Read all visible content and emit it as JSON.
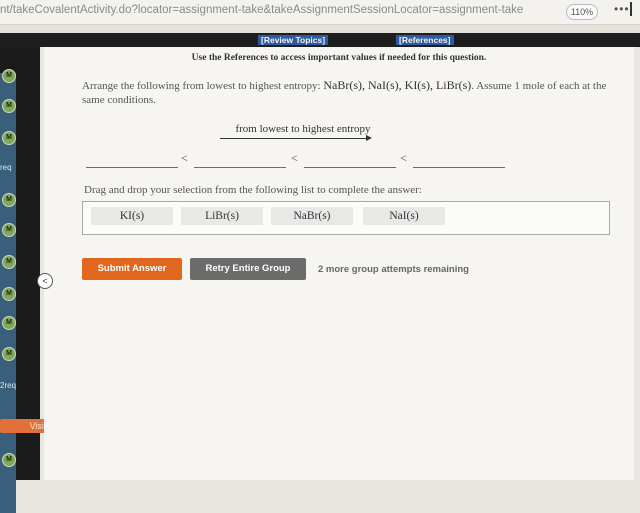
{
  "browser": {
    "url": "nt/takeCovalentActivity.do?locator=assignment-take&takeAssignmentSessionLocator=assignment-take",
    "zoom": "110%",
    "menu_glyph": "•••"
  },
  "header": {
    "review_topics": "[Review Topics]",
    "references": "[References]"
  },
  "sidebar": {
    "badge_letter": "M",
    "tags": [
      "req",
      "2req"
    ],
    "visited_label": "Visited",
    "collapse_glyph": "<"
  },
  "content": {
    "reference_note": "Use the References to access important values if needed for this question.",
    "question_prefix": "Arrange the following from lowest to highest entropy: ",
    "question_species": "NaBr(s), NaI(s), KI(s), LiBr(s)",
    "question_suffix": ". Assume 1 mole of each at the same conditions.",
    "direction_label": "from lowest to highest entropy",
    "comparator": "<",
    "drag_instructions": "Drag and drop your selection from the following list to complete the answer:",
    "options": [
      "KI(s)",
      "LiBr(s)",
      "NaBr(s)",
      "NaI(s)"
    ]
  },
  "actions": {
    "submit_label": "Submit Answer",
    "retry_label": "Retry Entire Group",
    "attempts_text": "2 more group attempts remaining"
  },
  "colors": {
    "submit": "#e0671d",
    "retry": "#6b6b6b",
    "answer_slot_line": "#4a6fb0",
    "sidebar_badge": "#7fa85a",
    "visited": "#e3703a"
  }
}
